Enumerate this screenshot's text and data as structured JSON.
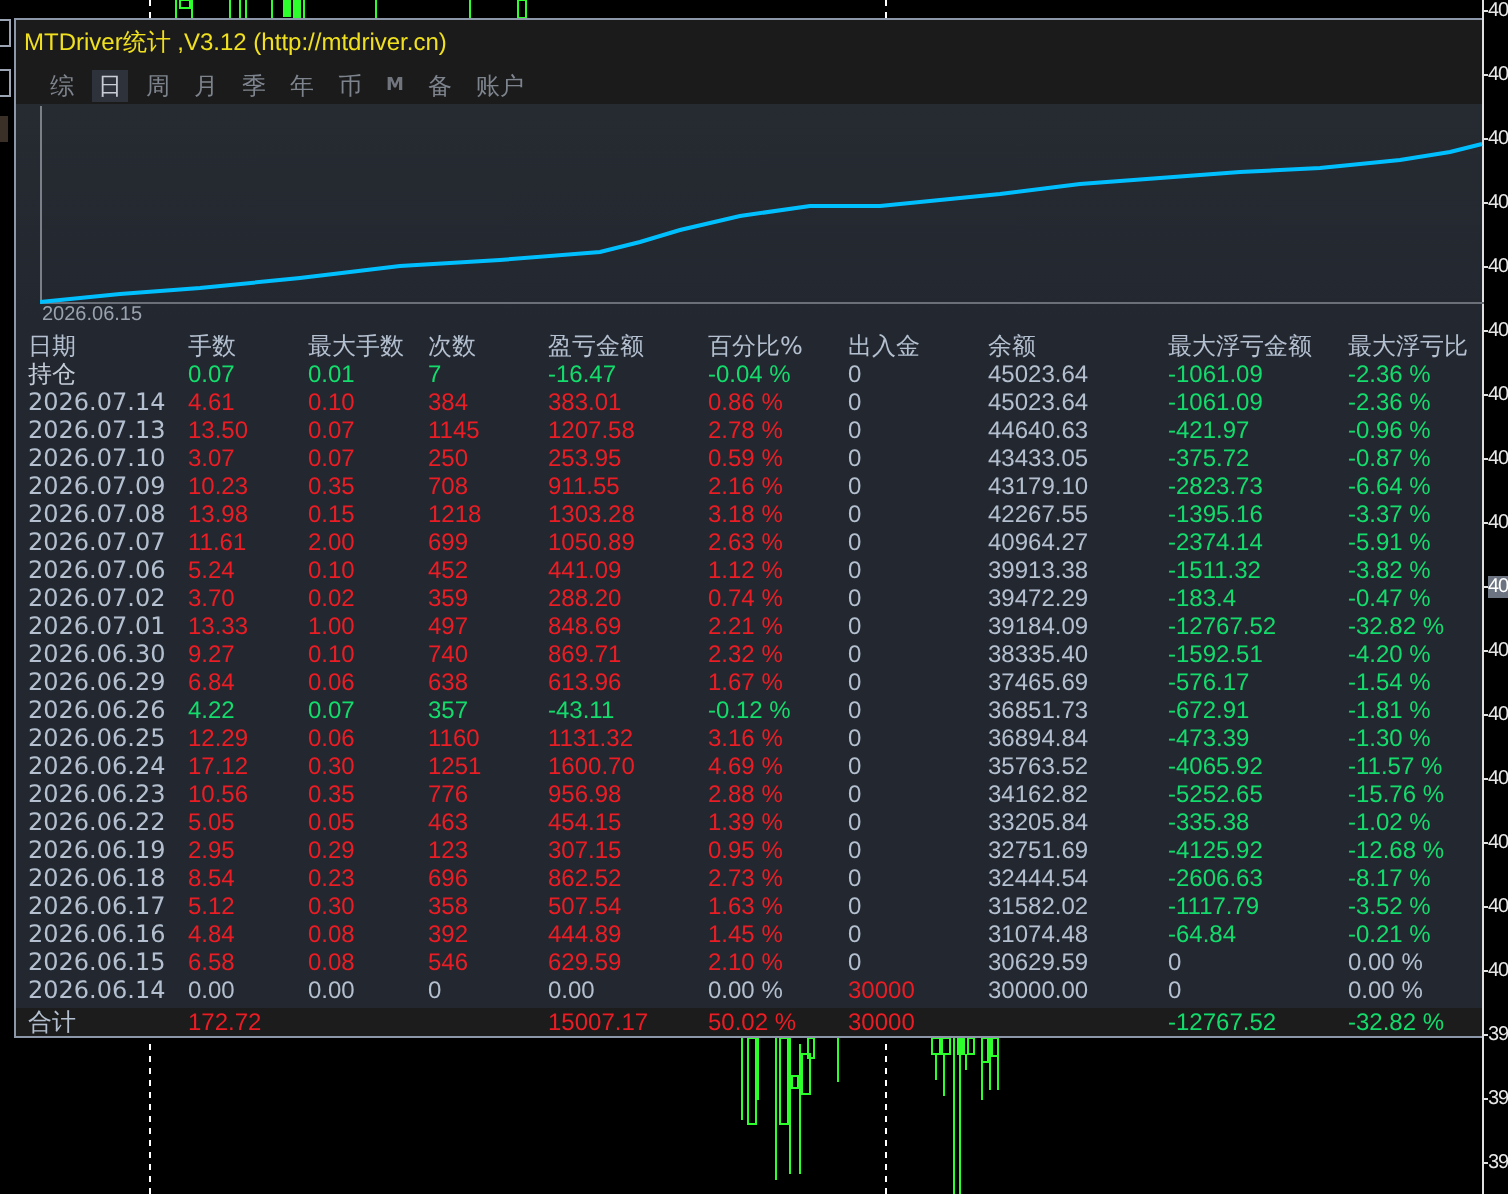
{
  "window": {
    "title": "MTDriver统计 ,V3.12 (http://mtdriver.cn)"
  },
  "tabs": [
    {
      "label": "综",
      "selected": false
    },
    {
      "label": "日",
      "selected": true
    },
    {
      "label": "周",
      "selected": false
    },
    {
      "label": "月",
      "selected": false
    },
    {
      "label": "季",
      "selected": false
    },
    {
      "label": "年",
      "selected": false
    },
    {
      "label": "币",
      "selected": false
    },
    {
      "label": "M",
      "selected": false
    },
    {
      "label": "备",
      "selected": false
    },
    {
      "label": "账户",
      "selected": false
    }
  ],
  "equity_chart": {
    "start_label": "2026.06.15"
  },
  "table": {
    "columns": [
      "日期",
      "手数",
      "最大手数",
      "次数",
      "盈亏金额",
      "百分比%",
      "出入金",
      "余额",
      "最大浮亏金额",
      "最大浮亏比"
    ],
    "rows": [
      {
        "cells": [
          {
            "text": "持仓",
            "color": "#c4ccd8"
          },
          {
            "text": "0.07",
            "color": "#14dc6c"
          },
          {
            "text": "0.01",
            "color": "#14dc6c"
          },
          {
            "text": "7",
            "color": "#14dc6c"
          },
          {
            "text": "-16.47",
            "color": "#14dc6c"
          },
          {
            "text": "-0.04 %",
            "color": "#14dc6c"
          },
          {
            "text": "0",
            "color": "#b4c0d0"
          },
          {
            "text": "45023.64",
            "color": "#b4c0d0"
          },
          {
            "text": "-1061.09",
            "color": "#14dc6c"
          },
          {
            "text": "-2.36 %",
            "color": "#14dc6c"
          }
        ]
      },
      {
        "cells": [
          {
            "text": "2026.07.14",
            "color": "#b4c0d0"
          },
          {
            "text": "4.61",
            "color": "#ec1c24"
          },
          {
            "text": "0.10",
            "color": "#ec1c24"
          },
          {
            "text": "384",
            "color": "#ec1c24"
          },
          {
            "text": "383.01",
            "color": "#ec1c24"
          },
          {
            "text": "0.86 %",
            "color": "#ec1c24"
          },
          {
            "text": "0",
            "color": "#b4c0d0"
          },
          {
            "text": "45023.64",
            "color": "#b4c0d0"
          },
          {
            "text": "-1061.09",
            "color": "#14dc6c"
          },
          {
            "text": "-2.36 %",
            "color": "#14dc6c"
          }
        ]
      },
      {
        "cells": [
          {
            "text": "2026.07.13",
            "color": "#b4c0d0"
          },
          {
            "text": "13.50",
            "color": "#ec1c24"
          },
          {
            "text": "0.07",
            "color": "#ec1c24"
          },
          {
            "text": "1145",
            "color": "#ec1c24"
          },
          {
            "text": "1207.58",
            "color": "#ec1c24"
          },
          {
            "text": "2.78 %",
            "color": "#ec1c24"
          },
          {
            "text": "0",
            "color": "#b4c0d0"
          },
          {
            "text": "44640.63",
            "color": "#b4c0d0"
          },
          {
            "text": "-421.97",
            "color": "#14dc6c"
          },
          {
            "text": "-0.96 %",
            "color": "#14dc6c"
          }
        ]
      },
      {
        "cells": [
          {
            "text": "2026.07.10",
            "color": "#b4c0d0"
          },
          {
            "text": "3.07",
            "color": "#ec1c24"
          },
          {
            "text": "0.07",
            "color": "#ec1c24"
          },
          {
            "text": "250",
            "color": "#ec1c24"
          },
          {
            "text": "253.95",
            "color": "#ec1c24"
          },
          {
            "text": "0.59 %",
            "color": "#ec1c24"
          },
          {
            "text": "0",
            "color": "#b4c0d0"
          },
          {
            "text": "43433.05",
            "color": "#b4c0d0"
          },
          {
            "text": "-375.72",
            "color": "#14dc6c"
          },
          {
            "text": "-0.87 %",
            "color": "#14dc6c"
          }
        ]
      },
      {
        "cells": [
          {
            "text": "2026.07.09",
            "color": "#b4c0d0"
          },
          {
            "text": "10.23",
            "color": "#ec1c24"
          },
          {
            "text": "0.35",
            "color": "#ec1c24"
          },
          {
            "text": "708",
            "color": "#ec1c24"
          },
          {
            "text": "911.55",
            "color": "#ec1c24"
          },
          {
            "text": "2.16 %",
            "color": "#ec1c24"
          },
          {
            "text": "0",
            "color": "#b4c0d0"
          },
          {
            "text": "43179.10",
            "color": "#b4c0d0"
          },
          {
            "text": "-2823.73",
            "color": "#14dc6c"
          },
          {
            "text": "-6.64 %",
            "color": "#14dc6c"
          }
        ]
      },
      {
        "cells": [
          {
            "text": "2026.07.08",
            "color": "#b4c0d0"
          },
          {
            "text": "13.98",
            "color": "#ec1c24"
          },
          {
            "text": "0.15",
            "color": "#ec1c24"
          },
          {
            "text": "1218",
            "color": "#ec1c24"
          },
          {
            "text": "1303.28",
            "color": "#ec1c24"
          },
          {
            "text": "3.18 %",
            "color": "#ec1c24"
          },
          {
            "text": "0",
            "color": "#b4c0d0"
          },
          {
            "text": "42267.55",
            "color": "#b4c0d0"
          },
          {
            "text": "-1395.16",
            "color": "#14dc6c"
          },
          {
            "text": "-3.37 %",
            "color": "#14dc6c"
          }
        ]
      },
      {
        "cells": [
          {
            "text": "2026.07.07",
            "color": "#b4c0d0"
          },
          {
            "text": "11.61",
            "color": "#ec1c24"
          },
          {
            "text": "2.00",
            "color": "#ec1c24"
          },
          {
            "text": "699",
            "color": "#ec1c24"
          },
          {
            "text": "1050.89",
            "color": "#ec1c24"
          },
          {
            "text": "2.63 %",
            "color": "#ec1c24"
          },
          {
            "text": "0",
            "color": "#b4c0d0"
          },
          {
            "text": "40964.27",
            "color": "#b4c0d0"
          },
          {
            "text": "-2374.14",
            "color": "#14dc6c"
          },
          {
            "text": "-5.91 %",
            "color": "#14dc6c"
          }
        ]
      },
      {
        "cells": [
          {
            "text": "2026.07.06",
            "color": "#b4c0d0"
          },
          {
            "text": "5.24",
            "color": "#ec1c24"
          },
          {
            "text": "0.10",
            "color": "#ec1c24"
          },
          {
            "text": "452",
            "color": "#ec1c24"
          },
          {
            "text": "441.09",
            "color": "#ec1c24"
          },
          {
            "text": "1.12 %",
            "color": "#ec1c24"
          },
          {
            "text": "0",
            "color": "#b4c0d0"
          },
          {
            "text": "39913.38",
            "color": "#b4c0d0"
          },
          {
            "text": "-1511.32",
            "color": "#14dc6c"
          },
          {
            "text": "-3.82 %",
            "color": "#14dc6c"
          }
        ]
      },
      {
        "cells": [
          {
            "text": "2026.07.02",
            "color": "#b4c0d0"
          },
          {
            "text": "3.70",
            "color": "#ec1c24"
          },
          {
            "text": "0.02",
            "color": "#ec1c24"
          },
          {
            "text": "359",
            "color": "#ec1c24"
          },
          {
            "text": "288.20",
            "color": "#ec1c24"
          },
          {
            "text": "0.74 %",
            "color": "#ec1c24"
          },
          {
            "text": "0",
            "color": "#b4c0d0"
          },
          {
            "text": "39472.29",
            "color": "#b4c0d0"
          },
          {
            "text": "-183.4",
            "color": "#14dc6c"
          },
          {
            "text": "-0.47 %",
            "color": "#14dc6c"
          }
        ]
      },
      {
        "cells": [
          {
            "text": "2026.07.01",
            "color": "#b4c0d0"
          },
          {
            "text": "13.33",
            "color": "#ec1c24"
          },
          {
            "text": "1.00",
            "color": "#ec1c24"
          },
          {
            "text": "497",
            "color": "#ec1c24"
          },
          {
            "text": "848.69",
            "color": "#ec1c24"
          },
          {
            "text": "2.21 %",
            "color": "#ec1c24"
          },
          {
            "text": "0",
            "color": "#b4c0d0"
          },
          {
            "text": "39184.09",
            "color": "#b4c0d0"
          },
          {
            "text": "-12767.52",
            "color": "#14dc6c"
          },
          {
            "text": "-32.82 %",
            "color": "#14dc6c"
          }
        ]
      },
      {
        "cells": [
          {
            "text": "2026.06.30",
            "color": "#b4c0d0"
          },
          {
            "text": "9.27",
            "color": "#ec1c24"
          },
          {
            "text": "0.10",
            "color": "#ec1c24"
          },
          {
            "text": "740",
            "color": "#ec1c24"
          },
          {
            "text": "869.71",
            "color": "#ec1c24"
          },
          {
            "text": "2.32 %",
            "color": "#ec1c24"
          },
          {
            "text": "0",
            "color": "#b4c0d0"
          },
          {
            "text": "38335.40",
            "color": "#b4c0d0"
          },
          {
            "text": "-1592.51",
            "color": "#14dc6c"
          },
          {
            "text": "-4.20 %",
            "color": "#14dc6c"
          }
        ]
      },
      {
        "cells": [
          {
            "text": "2026.06.29",
            "color": "#b4c0d0"
          },
          {
            "text": "6.84",
            "color": "#ec1c24"
          },
          {
            "text": "0.06",
            "color": "#ec1c24"
          },
          {
            "text": "638",
            "color": "#ec1c24"
          },
          {
            "text": "613.96",
            "color": "#ec1c24"
          },
          {
            "text": "1.67 %",
            "color": "#ec1c24"
          },
          {
            "text": "0",
            "color": "#b4c0d0"
          },
          {
            "text": "37465.69",
            "color": "#b4c0d0"
          },
          {
            "text": "-576.17",
            "color": "#14dc6c"
          },
          {
            "text": "-1.54 %",
            "color": "#14dc6c"
          }
        ]
      },
      {
        "cells": [
          {
            "text": "2026.06.26",
            "color": "#b4c0d0"
          },
          {
            "text": "4.22",
            "color": "#14dc6c"
          },
          {
            "text": "0.07",
            "color": "#14dc6c"
          },
          {
            "text": "357",
            "color": "#14dc6c"
          },
          {
            "text": "-43.11",
            "color": "#14dc6c"
          },
          {
            "text": "-0.12 %",
            "color": "#14dc6c"
          },
          {
            "text": "0",
            "color": "#b4c0d0"
          },
          {
            "text": "36851.73",
            "color": "#b4c0d0"
          },
          {
            "text": "-672.91",
            "color": "#14dc6c"
          },
          {
            "text": "-1.81 %",
            "color": "#14dc6c"
          }
        ]
      },
      {
        "cells": [
          {
            "text": "2026.06.25",
            "color": "#b4c0d0"
          },
          {
            "text": "12.29",
            "color": "#ec1c24"
          },
          {
            "text": "0.06",
            "color": "#ec1c24"
          },
          {
            "text": "1160",
            "color": "#ec1c24"
          },
          {
            "text": "1131.32",
            "color": "#ec1c24"
          },
          {
            "text": "3.16 %",
            "color": "#ec1c24"
          },
          {
            "text": "0",
            "color": "#b4c0d0"
          },
          {
            "text": "36894.84",
            "color": "#b4c0d0"
          },
          {
            "text": "-473.39",
            "color": "#14dc6c"
          },
          {
            "text": "-1.30 %",
            "color": "#14dc6c"
          }
        ]
      },
      {
        "cells": [
          {
            "text": "2026.06.24",
            "color": "#b4c0d0"
          },
          {
            "text": "17.12",
            "color": "#ec1c24"
          },
          {
            "text": "0.30",
            "color": "#ec1c24"
          },
          {
            "text": "1251",
            "color": "#ec1c24"
          },
          {
            "text": "1600.70",
            "color": "#ec1c24"
          },
          {
            "text": "4.69 %",
            "color": "#ec1c24"
          },
          {
            "text": "0",
            "color": "#b4c0d0"
          },
          {
            "text": "35763.52",
            "color": "#b4c0d0"
          },
          {
            "text": "-4065.92",
            "color": "#14dc6c"
          },
          {
            "text": "-11.57 %",
            "color": "#14dc6c"
          }
        ]
      },
      {
        "cells": [
          {
            "text": "2026.06.23",
            "color": "#b4c0d0"
          },
          {
            "text": "10.56",
            "color": "#ec1c24"
          },
          {
            "text": "0.35",
            "color": "#ec1c24"
          },
          {
            "text": "776",
            "color": "#ec1c24"
          },
          {
            "text": "956.98",
            "color": "#ec1c24"
          },
          {
            "text": "2.88 %",
            "color": "#ec1c24"
          },
          {
            "text": "0",
            "color": "#b4c0d0"
          },
          {
            "text": "34162.82",
            "color": "#b4c0d0"
          },
          {
            "text": "-5252.65",
            "color": "#14dc6c"
          },
          {
            "text": "-15.76 %",
            "color": "#14dc6c"
          }
        ]
      },
      {
        "cells": [
          {
            "text": "2026.06.22",
            "color": "#b4c0d0"
          },
          {
            "text": "5.05",
            "color": "#ec1c24"
          },
          {
            "text": "0.05",
            "color": "#ec1c24"
          },
          {
            "text": "463",
            "color": "#ec1c24"
          },
          {
            "text": "454.15",
            "color": "#ec1c24"
          },
          {
            "text": "1.39 %",
            "color": "#ec1c24"
          },
          {
            "text": "0",
            "color": "#b4c0d0"
          },
          {
            "text": "33205.84",
            "color": "#b4c0d0"
          },
          {
            "text": "-335.38",
            "color": "#14dc6c"
          },
          {
            "text": "-1.02 %",
            "color": "#14dc6c"
          }
        ]
      },
      {
        "cells": [
          {
            "text": "2026.06.19",
            "color": "#b4c0d0"
          },
          {
            "text": "2.95",
            "color": "#ec1c24"
          },
          {
            "text": "0.29",
            "color": "#ec1c24"
          },
          {
            "text": "123",
            "color": "#ec1c24"
          },
          {
            "text": "307.15",
            "color": "#ec1c24"
          },
          {
            "text": "0.95 %",
            "color": "#ec1c24"
          },
          {
            "text": "0",
            "color": "#b4c0d0"
          },
          {
            "text": "32751.69",
            "color": "#b4c0d0"
          },
          {
            "text": "-4125.92",
            "color": "#14dc6c"
          },
          {
            "text": "-12.68 %",
            "color": "#14dc6c"
          }
        ]
      },
      {
        "cells": [
          {
            "text": "2026.06.18",
            "color": "#b4c0d0"
          },
          {
            "text": "8.54",
            "color": "#ec1c24"
          },
          {
            "text": "0.23",
            "color": "#ec1c24"
          },
          {
            "text": "696",
            "color": "#ec1c24"
          },
          {
            "text": "862.52",
            "color": "#ec1c24"
          },
          {
            "text": "2.73 %",
            "color": "#ec1c24"
          },
          {
            "text": "0",
            "color": "#b4c0d0"
          },
          {
            "text": "32444.54",
            "color": "#b4c0d0"
          },
          {
            "text": "-2606.63",
            "color": "#14dc6c"
          },
          {
            "text": "-8.17 %",
            "color": "#14dc6c"
          }
        ]
      },
      {
        "cells": [
          {
            "text": "2026.06.17",
            "color": "#b4c0d0"
          },
          {
            "text": "5.12",
            "color": "#ec1c24"
          },
          {
            "text": "0.30",
            "color": "#ec1c24"
          },
          {
            "text": "358",
            "color": "#ec1c24"
          },
          {
            "text": "507.54",
            "color": "#ec1c24"
          },
          {
            "text": "1.63 %",
            "color": "#ec1c24"
          },
          {
            "text": "0",
            "color": "#b4c0d0"
          },
          {
            "text": "31582.02",
            "color": "#b4c0d0"
          },
          {
            "text": "-1117.79",
            "color": "#14dc6c"
          },
          {
            "text": "-3.52 %",
            "color": "#14dc6c"
          }
        ]
      },
      {
        "cells": [
          {
            "text": "2026.06.16",
            "color": "#b4c0d0"
          },
          {
            "text": "4.84",
            "color": "#ec1c24"
          },
          {
            "text": "0.08",
            "color": "#ec1c24"
          },
          {
            "text": "392",
            "color": "#ec1c24"
          },
          {
            "text": "444.89",
            "color": "#ec1c24"
          },
          {
            "text": "1.45 %",
            "color": "#ec1c24"
          },
          {
            "text": "0",
            "color": "#b4c0d0"
          },
          {
            "text": "31074.48",
            "color": "#b4c0d0"
          },
          {
            "text": "-64.84",
            "color": "#14dc6c"
          },
          {
            "text": "-0.21 %",
            "color": "#14dc6c"
          }
        ]
      },
      {
        "cells": [
          {
            "text": "2026.06.15",
            "color": "#b4c0d0"
          },
          {
            "text": "6.58",
            "color": "#ec1c24"
          },
          {
            "text": "0.08",
            "color": "#ec1c24"
          },
          {
            "text": "546",
            "color": "#ec1c24"
          },
          {
            "text": "629.59",
            "color": "#ec1c24"
          },
          {
            "text": "2.10 %",
            "color": "#ec1c24"
          },
          {
            "text": "0",
            "color": "#b4c0d0"
          },
          {
            "text": "30629.59",
            "color": "#b4c0d0"
          },
          {
            "text": "0",
            "color": "#b4c0d0"
          },
          {
            "text": "0.00 %",
            "color": "#b4c0d0"
          }
        ]
      },
      {
        "cells": [
          {
            "text": "2026.06.14",
            "color": "#b4c0d0"
          },
          {
            "text": "0.00",
            "color": "#b4c0d0"
          },
          {
            "text": "0.00",
            "color": "#b4c0d0"
          },
          {
            "text": "0",
            "color": "#b4c0d0"
          },
          {
            "text": "0.00",
            "color": "#b4c0d0"
          },
          {
            "text": "0.00 %",
            "color": "#b4c0d0"
          },
          {
            "text": "30000",
            "color": "#ec1c24"
          },
          {
            "text": "30000.00",
            "color": "#b4c0d0"
          },
          {
            "text": "0",
            "color": "#b4c0d0"
          },
          {
            "text": "0.00 %",
            "color": "#b4c0d0"
          }
        ]
      }
    ],
    "total": {
      "label": "合计",
      "lots": {
        "text": "172.72",
        "color": "#ec1c24"
      },
      "profit": {
        "text": "15007.17",
        "color": "#ec1c24"
      },
      "percent": {
        "text": "50.02 %",
        "color": "#ec1c24"
      },
      "deposit": {
        "text": "30000",
        "color": "#ec1c24"
      },
      "max_drawdown": {
        "text": "-12767.52",
        "color": "#14dc6c"
      },
      "max_drawdown_pct": {
        "text": "-32.82 %",
        "color": "#14dc6c"
      }
    }
  },
  "price_axis": {
    "labels": [
      {
        "text": "40",
        "highlighted": false
      },
      {
        "text": "40",
        "highlighted": false
      },
      {
        "text": "40",
        "highlighted": false
      },
      {
        "text": "40",
        "highlighted": false
      },
      {
        "text": "40",
        "highlighted": false
      },
      {
        "text": "40",
        "highlighted": false
      },
      {
        "text": "40",
        "highlighted": false
      },
      {
        "text": "40",
        "highlighted": false
      },
      {
        "text": "40",
        "highlighted": false
      },
      {
        "text": "40",
        "highlighted": true
      },
      {
        "text": "40",
        "highlighted": false
      },
      {
        "text": "40",
        "highlighted": false
      },
      {
        "text": "40",
        "highlighted": false
      },
      {
        "text": "40",
        "highlighted": false
      },
      {
        "text": "40",
        "highlighted": false
      },
      {
        "text": "40",
        "highlighted": false
      },
      {
        "text": "39",
        "highlighted": false
      },
      {
        "text": "39",
        "highlighted": false
      },
      {
        "text": "39",
        "highlighted": false
      }
    ]
  }
}
